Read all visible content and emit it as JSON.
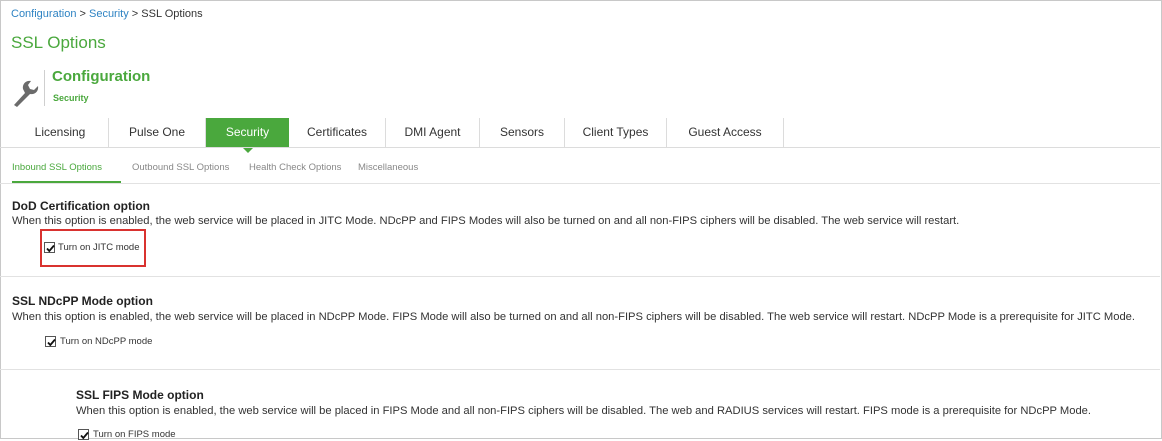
{
  "breadcrumb": {
    "item1": "Configuration",
    "sep1": " > ",
    "item2": "Security",
    "sep2": " > ",
    "current": "SSL Options"
  },
  "page_title": "SSL Options",
  "header": {
    "icon": "wrench-icon",
    "title": "Configuration",
    "subtitle": "Security"
  },
  "tabs": [
    {
      "label": "Licensing",
      "active": false
    },
    {
      "label": "Pulse One",
      "active": false
    },
    {
      "label": "Security",
      "active": true
    },
    {
      "label": "Certificates",
      "active": false
    },
    {
      "label": "DMI Agent",
      "active": false
    },
    {
      "label": "Sensors",
      "active": false
    },
    {
      "label": "Client Types",
      "active": false
    },
    {
      "label": "Guest Access",
      "active": false
    }
  ],
  "subtabs": [
    {
      "label": "Inbound SSL Options",
      "active": true
    },
    {
      "label": "Outbound SSL Options",
      "active": false
    },
    {
      "label": "Health Check Options",
      "active": false
    },
    {
      "label": "Miscellaneous",
      "active": false
    }
  ],
  "sections": [
    {
      "title": "DoD Certification option",
      "description": "When this option is enabled, the web service will be placed in JITC Mode. NDcPP and FIPS Modes will also be turned on and all non-FIPS ciphers will be disabled. The web service will restart.",
      "checkbox_label": "Turn on JITC mode",
      "checked": true
    },
    {
      "title": "SSL NDcPP Mode option",
      "description": "When this option is enabled, the web service will be placed in NDcPP Mode. FIPS Mode will also be turned on and all non-FIPS ciphers will be disabled. The web service will restart. NDcPP Mode is a prerequisite for JITC Mode.",
      "checkbox_label": "Turn on NDcPP mode",
      "checked": true
    },
    {
      "title": "SSL FIPS Mode option",
      "description": "When this option is enabled, the web service will be placed in FIPS Mode and all non-FIPS ciphers will be disabled. The web and RADIUS services will restart. FIPS mode is a prerequisite for NDcPP Mode.",
      "checkbox_label": "Turn on FIPS mode",
      "checked": true
    }
  ],
  "colors": {
    "accent": "#4aa83d",
    "link": "#2e83c3",
    "highlight": "#d9322f"
  }
}
